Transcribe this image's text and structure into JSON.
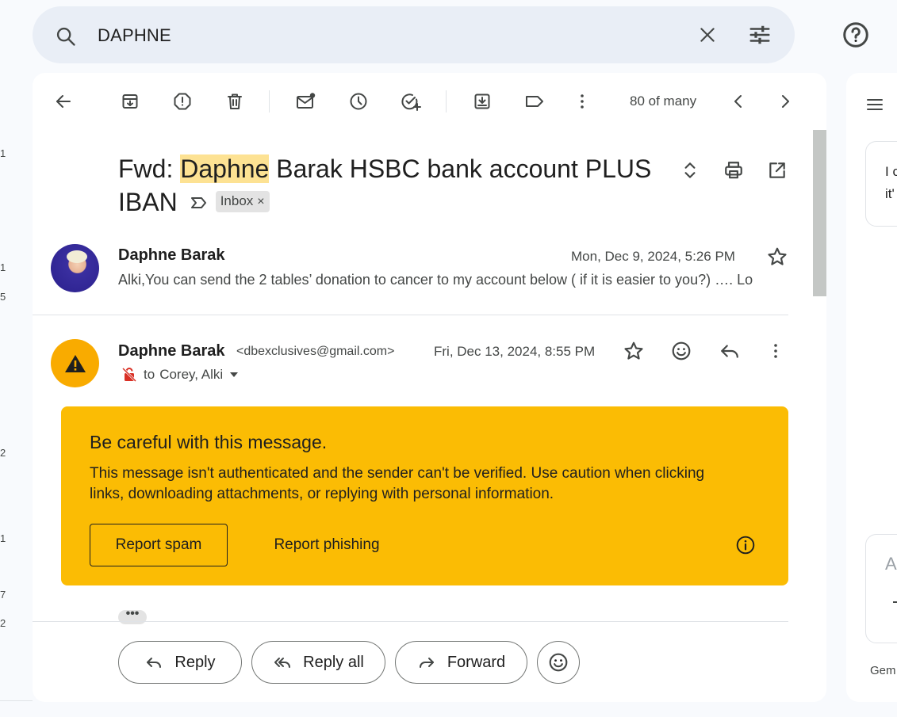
{
  "left_strip": [
    "1",
    "1",
    "5",
    "2",
    "1",
    "7",
    "2"
  ],
  "search": {
    "query": "DAPHNE"
  },
  "toolbar": {
    "count": "80 of many"
  },
  "thread": {
    "subject_prefix": "Fwd: ",
    "subject_highlight": "Daphne",
    "subject_rest": " Barak HSBC bank account PLUS IBAN",
    "label": "Inbox",
    "label_remove": "×"
  },
  "message1": {
    "sender": "Daphne Barak",
    "date": "Mon, Dec 9, 2024, 5:26 PM",
    "snippet": "Alki,You can send the 2 tables’ donation to cancer to my account below ( if it is easier to you?) …. Lo"
  },
  "message2": {
    "sender": "Daphne Barak",
    "email": "<dbexclusives@gmail.com>",
    "date": "Fri, Dec 13, 2024, 8:55 PM",
    "to_prefix": "to",
    "recipients": "Corey, Alki"
  },
  "warning": {
    "title": "Be careful with this message.",
    "body": "This message isn't authenticated and the sender can't be verified. Use caution when clicking links, downloading attachments, or replying with personal information.",
    "report_spam": "Report spam",
    "report_phishing": "Report phishing",
    "color": "#fbbc04"
  },
  "more_content": "•••",
  "actions": {
    "reply": "Reply",
    "reply_all": "Reply all",
    "forward": "Forward"
  },
  "side_panel": {
    "card_line1": "I c",
    "card_line2": "it'",
    "input_hint": "A",
    "footer": "Gem"
  },
  "colors": {
    "highlight": "#fde293",
    "warning_avatar": "#f9ab00"
  }
}
